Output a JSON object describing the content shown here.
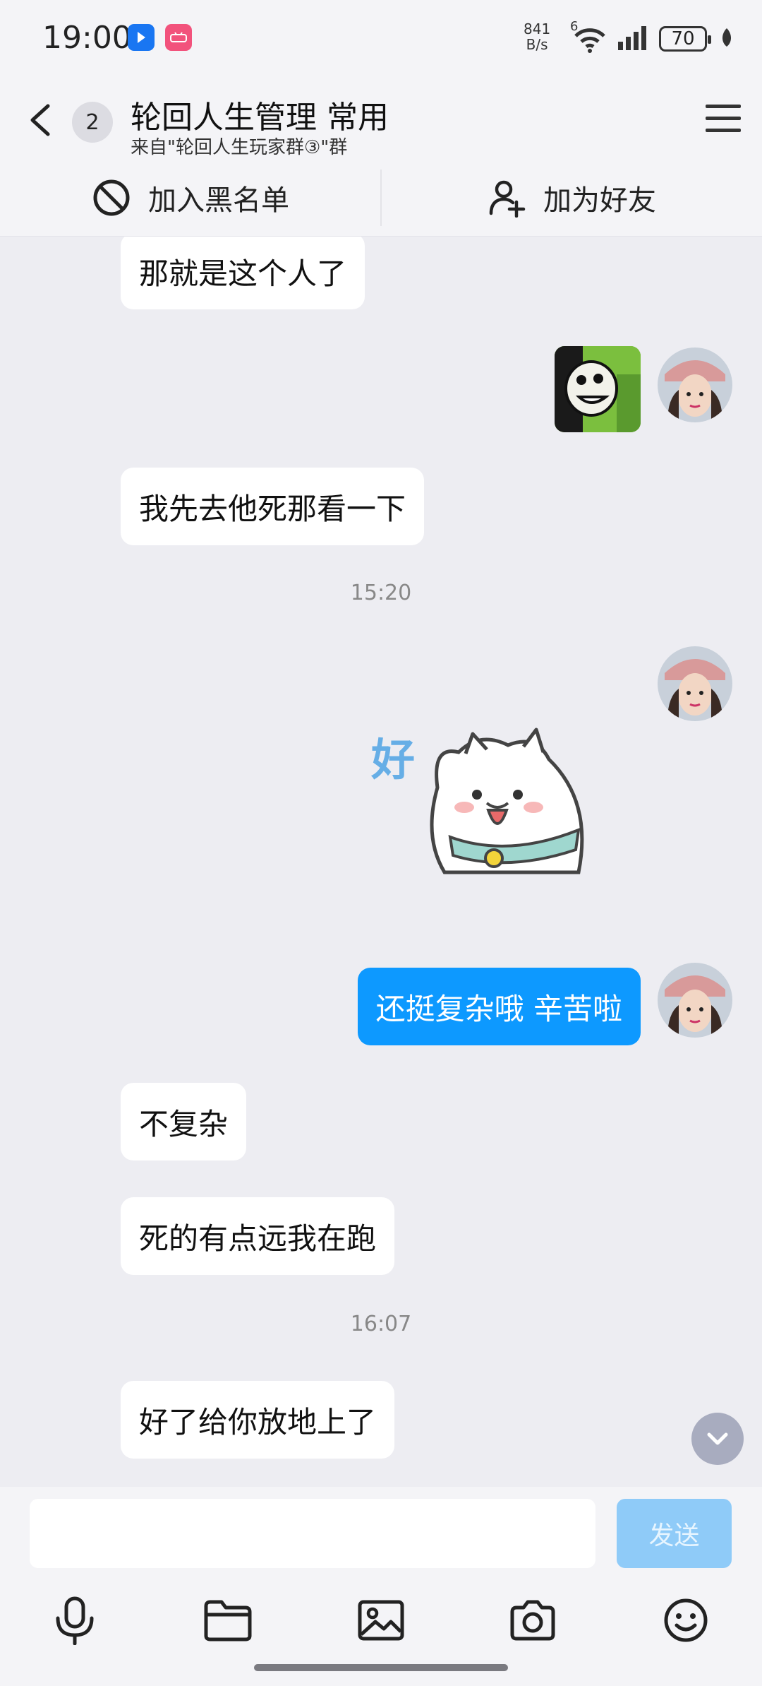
{
  "status_bar": {
    "time": "19:00",
    "net_speed_value": "841",
    "net_speed_unit": "B/s",
    "wifi_label": "6",
    "battery": "70"
  },
  "header": {
    "unread_count": "2",
    "title": "轮回人生管理 常用",
    "subtitle": "来自\"轮回人生玩家群③\"群"
  },
  "actions": {
    "block_label": "加入黑名单",
    "add_friend_label": "加为好友"
  },
  "messages": {
    "m1": "那就是这个人了",
    "m2": "我先去他死那看一下",
    "time1": "15:20",
    "sticker_text": "好",
    "m3": "还挺复杂哦 辛苦啦",
    "m4": "不复杂",
    "m5": "死的有点远我在跑",
    "time2": "16:07",
    "m6": "好了给你放地上了"
  },
  "input": {
    "placeholder": "",
    "send_label": "发送"
  },
  "colors": {
    "self_bubble": "#0d99ff",
    "send_disabled": "#8fcbf8",
    "background": "#ededf2"
  }
}
